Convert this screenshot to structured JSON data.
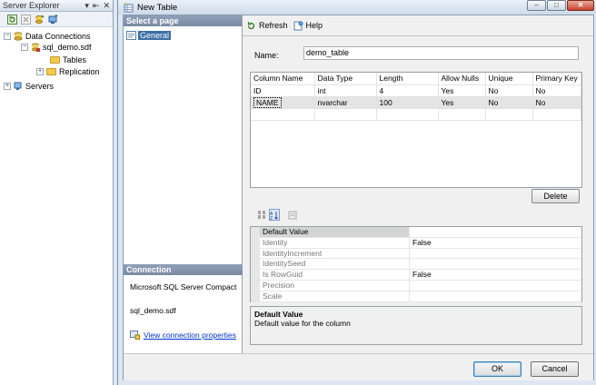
{
  "server_explorer": {
    "title": "Server Explorer",
    "title_controls": [
      "▾",
      "⇤",
      "✕"
    ],
    "tree": {
      "data_connections": "Data Connections",
      "db_file": "sql_demo.sdf",
      "tables": "Tables",
      "replication": "Replication",
      "servers": "Servers"
    }
  },
  "dialog": {
    "title": "New Table",
    "window_controls": {
      "minimize": "–",
      "maximize": "□",
      "close": "✕"
    },
    "select_page_header": "Select a page",
    "pages": [
      "General"
    ],
    "connection": {
      "header": "Connection",
      "server": "Microsoft SQL Server Compact",
      "database": "sql_demo.sdf",
      "view_link": "View connection properties"
    },
    "toolbar": {
      "refresh": "Refresh",
      "help": "Help"
    },
    "name_label": "Name:",
    "name_value": "demo_table",
    "columns": {
      "headers": [
        "Column Name",
        "Data Type",
        "Length",
        "Allow Nulls",
        "Unique",
        "Primary Key"
      ],
      "rows": [
        [
          "ID",
          "int",
          "4",
          "Yes",
          "No",
          "No"
        ],
        [
          "NAME",
          "nvarchar",
          "100",
          "Yes",
          "No",
          "No"
        ]
      ]
    },
    "delete_label": "Delete",
    "properties": [
      {
        "name": "Default Value",
        "value": ""
      },
      {
        "name": "Identity",
        "value": "False"
      },
      {
        "name": "IdentityIncrement",
        "value": ""
      },
      {
        "name": "IdentitySeed",
        "value": ""
      },
      {
        "name": "Is RowGuid",
        "value": "False"
      },
      {
        "name": "Precision",
        "value": ""
      },
      {
        "name": "Scale",
        "value": ""
      }
    ],
    "help_title": "Default Value",
    "help_text": "Default value for the column",
    "ok_label": "OK",
    "cancel_label": "Cancel"
  }
}
